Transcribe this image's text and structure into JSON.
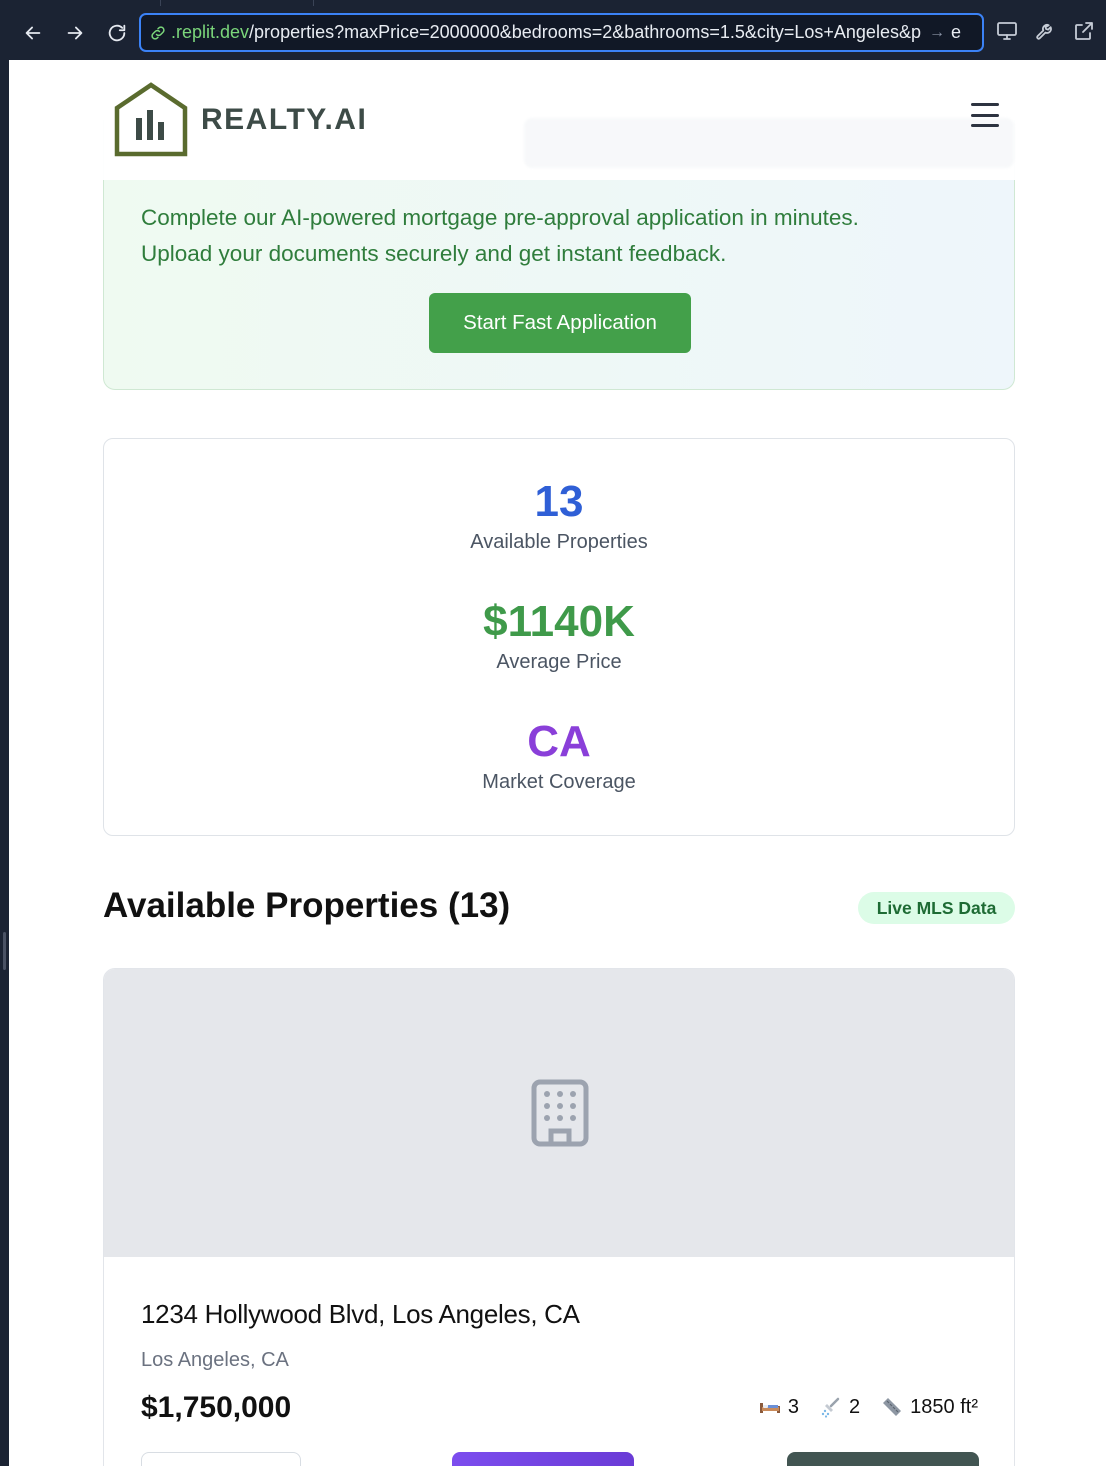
{
  "browser": {
    "url_domain": ".replit.dev",
    "url_path": "/properties?maxPrice=2000000&bedrooms=2&bathrooms=1.5&city=Los+Angeles&p",
    "url_arrow": "→",
    "url_trailing": "e"
  },
  "header": {
    "logo_text": "REALTY.AI"
  },
  "approval": {
    "line1": "Complete our AI-powered mortgage pre-approval application in minutes.",
    "line2": "Upload your documents securely and get instant feedback.",
    "button_label": "Start Fast Application"
  },
  "stats": [
    {
      "value": "13",
      "label": "Available Properties",
      "color": "#2f5fd6"
    },
    {
      "value": "$1140K",
      "label": "Average Price",
      "color": "#3f9a4a"
    },
    {
      "value": "CA",
      "label": "Market Coverage",
      "color": "#8a3fd9"
    }
  ],
  "listing": {
    "title": "Available Properties (13)",
    "badge": "Live MLS Data"
  },
  "property": {
    "address": "1234 Hollywood Blvd, Los Angeles, CA",
    "city": "Los Angeles, CA",
    "price": "$1,750,000",
    "bedrooms": "3",
    "bathrooms": "2",
    "area": "1850 ft²"
  },
  "icons": {
    "back": "arrow-left-icon",
    "forward": "arrow-right-icon",
    "reload": "reload-icon",
    "link": "link-icon",
    "monitor": "monitor-icon",
    "wrench": "wrench-icon",
    "external": "external-link-icon",
    "menu": "hamburger-menu-icon",
    "building": "building-icon",
    "bed": "bed-icon",
    "shower": "shower-icon",
    "ruler": "ruler-icon"
  }
}
